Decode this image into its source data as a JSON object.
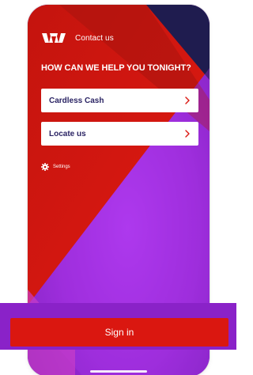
{
  "header": {
    "contact_label": "Contact us",
    "logo_icon": "westpac-w-logo"
  },
  "headline": "HOW CAN WE HELP YOU TONIGHT?",
  "options": [
    {
      "label": "Cardless Cash",
      "icon": "chevron-right-icon"
    },
    {
      "label": "Locate us",
      "icon": "chevron-right-icon"
    }
  ],
  "settings": {
    "label": "Settings",
    "icon": "gear-icon"
  },
  "sign_in": {
    "label": "Sign in"
  },
  "colors": {
    "brand_red": "#da1710",
    "navy": "#1f1c4f",
    "purple": "#9a2bd8",
    "card_text": "#2b2464"
  }
}
